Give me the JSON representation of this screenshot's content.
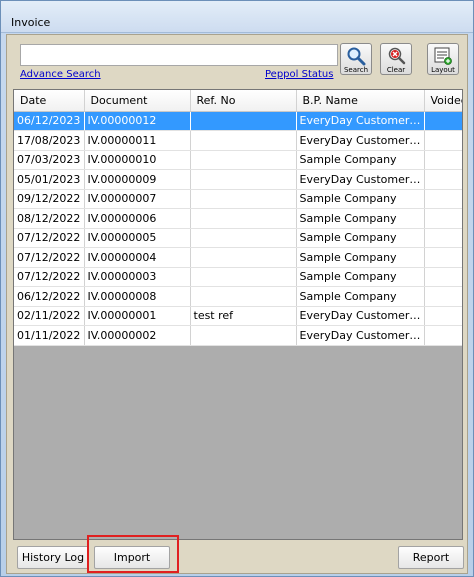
{
  "window": {
    "title": "Invoice"
  },
  "search": {
    "value": "",
    "placeholder": ""
  },
  "links": {
    "advance_search": "Advance Search",
    "peppol_status": "Peppol Status"
  },
  "toolbar": {
    "search": {
      "label": "Search",
      "icon": "magnifier-icon"
    },
    "clear": {
      "label": "Clear",
      "icon": "clear-icon"
    },
    "layout": {
      "label": "Layout",
      "icon": "layout-icon"
    }
  },
  "table": {
    "columns": [
      "Date",
      "Document",
      "Ref. No",
      "B.P. Name",
      "Voided"
    ],
    "rows": [
      {
        "date": "06/12/2023",
        "document": "IV.00000012",
        "ref": "",
        "bp": "EveryDay Customer P...",
        "voided": "",
        "selected": true
      },
      {
        "date": "17/08/2023",
        "document": "IV.00000011",
        "ref": "",
        "bp": "EveryDay Customer P...",
        "voided": ""
      },
      {
        "date": "07/03/2023",
        "document": "IV.00000010",
        "ref": "",
        "bp": "Sample Company",
        "voided": ""
      },
      {
        "date": "05/01/2023",
        "document": "IV.00000009",
        "ref": "",
        "bp": "EveryDay Customer P...",
        "voided": ""
      },
      {
        "date": "09/12/2022",
        "document": "IV.00000007",
        "ref": "",
        "bp": "Sample Company",
        "voided": ""
      },
      {
        "date": "08/12/2022",
        "document": "IV.00000006",
        "ref": "",
        "bp": "Sample Company",
        "voided": ""
      },
      {
        "date": "07/12/2022",
        "document": "IV.00000005",
        "ref": "",
        "bp": "Sample Company",
        "voided": ""
      },
      {
        "date": "07/12/2022",
        "document": "IV.00000004",
        "ref": "",
        "bp": "Sample Company",
        "voided": ""
      },
      {
        "date": "07/12/2022",
        "document": "IV.00000003",
        "ref": "",
        "bp": "Sample Company",
        "voided": ""
      },
      {
        "date": "06/12/2022",
        "document": "IV.00000008",
        "ref": "",
        "bp": "Sample Company",
        "voided": ""
      },
      {
        "date": "02/11/2022",
        "document": "IV.00000001",
        "ref": "test ref",
        "bp": "EveryDay Customer P...",
        "voided": ""
      },
      {
        "date": "01/11/2022",
        "document": "IV.00000002",
        "ref": "",
        "bp": "EveryDay Customer P...",
        "voided": ""
      }
    ]
  },
  "buttons": {
    "history_log": "History Log",
    "import": "Import",
    "report": "Report"
  },
  "colors": {
    "selection": "#3399ff",
    "link": "#0000cc",
    "highlight": "#e02020",
    "panel": "#ded8c4"
  }
}
